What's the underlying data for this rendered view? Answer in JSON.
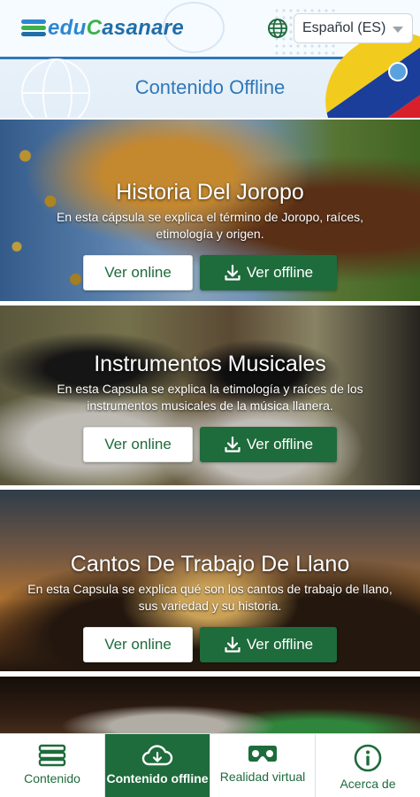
{
  "header": {
    "logo": {
      "part1": "edu",
      "part2": "C",
      "part3": "asanare"
    },
    "language_selected": "Español (ES)",
    "page_title": "Contenido Offline"
  },
  "cards": [
    {
      "title": "Historia Del Joropo",
      "description": "En esta cápsula se explica el término de Joropo, raíces, etimología y origen.",
      "online_label": "Ver online",
      "offline_label": "Ver offline"
    },
    {
      "title": "Instrumentos Musicales",
      "description": "En esta Capsula se explica la etimología y raíces de los instrumentos musicales de la música llanera.",
      "online_label": "Ver online",
      "offline_label": "Ver offline"
    },
    {
      "title": "Cantos De Trabajo De Llano",
      "description": "En esta Capsula se explica qué son los cantos de trabajo de llano, sus variedad y su historia.",
      "online_label": "Ver online",
      "offline_label": "Ver offline"
    }
  ],
  "bottom_nav": [
    {
      "label": "Contenido",
      "icon": "stack-icon",
      "active": false
    },
    {
      "label": "Contenido offline",
      "icon": "cloud-download-icon",
      "active": true
    },
    {
      "label": "Realidad virtual",
      "icon": "vr-headset-icon",
      "active": false
    },
    {
      "label": "Acerca de",
      "icon": "info-icon",
      "active": false
    }
  ],
  "colors": {
    "primary_green": "#1e6b3c",
    "title_blue": "#2f78b9",
    "logo_blue": "#2b87d3",
    "logo_green": "#3bb24a"
  }
}
